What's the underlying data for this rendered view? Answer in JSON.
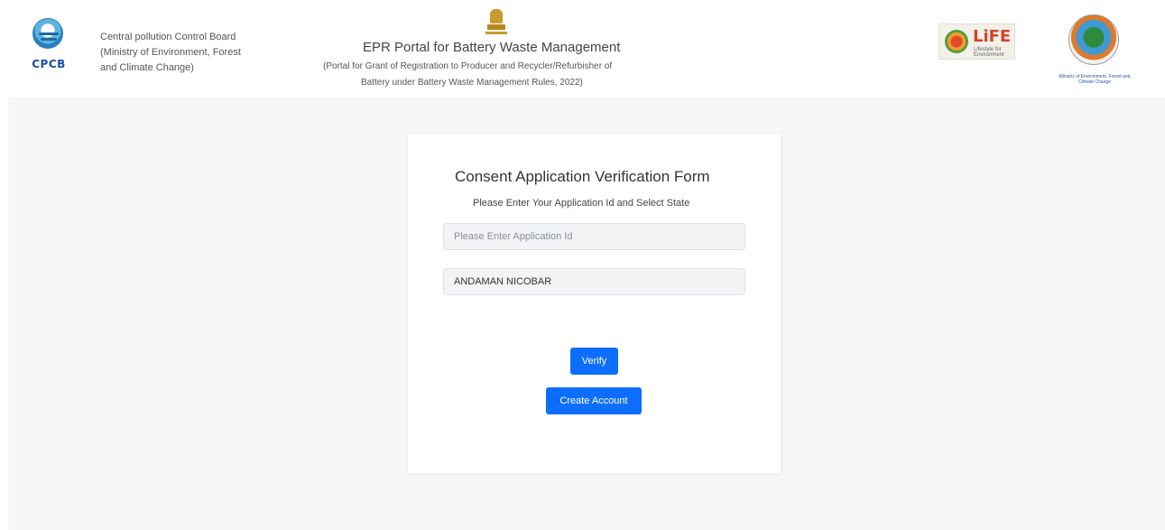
{
  "header": {
    "cpcb_logo_text": "CPCB",
    "board_lines": [
      "Central pollution Control Board",
      "(Ministry of Environment, Forest",
      "and Climate Change)"
    ],
    "portal_title": "EPR Portal for Battery Waste Management",
    "portal_subtitle_line1": "(Portal for Grant of Registration to Producer and Recycler/Refurbisher of",
    "portal_subtitle_line2": "Battery under Battery Waste Management Rules, 2022)",
    "life_logo_text": "LiFE",
    "life_logo_small": "Lifestyle for Environment",
    "moef_caption": "Ministry of Environment, Forest and Climate Change"
  },
  "form": {
    "title": "Consent Application Verification Form",
    "subtitle": "Please Enter Your Application Id and Select State",
    "application_id_placeholder": "Please Enter Application Id",
    "application_id_value": "",
    "state_selected": "ANDAMAN NICOBAR",
    "verify_label": "Verify",
    "create_account_label": "Create Account"
  },
  "colors": {
    "primary_button": "#0d6efd",
    "page_background": "#f5f6f7",
    "card_background": "#ffffff",
    "input_background": "#f1f3f5"
  }
}
